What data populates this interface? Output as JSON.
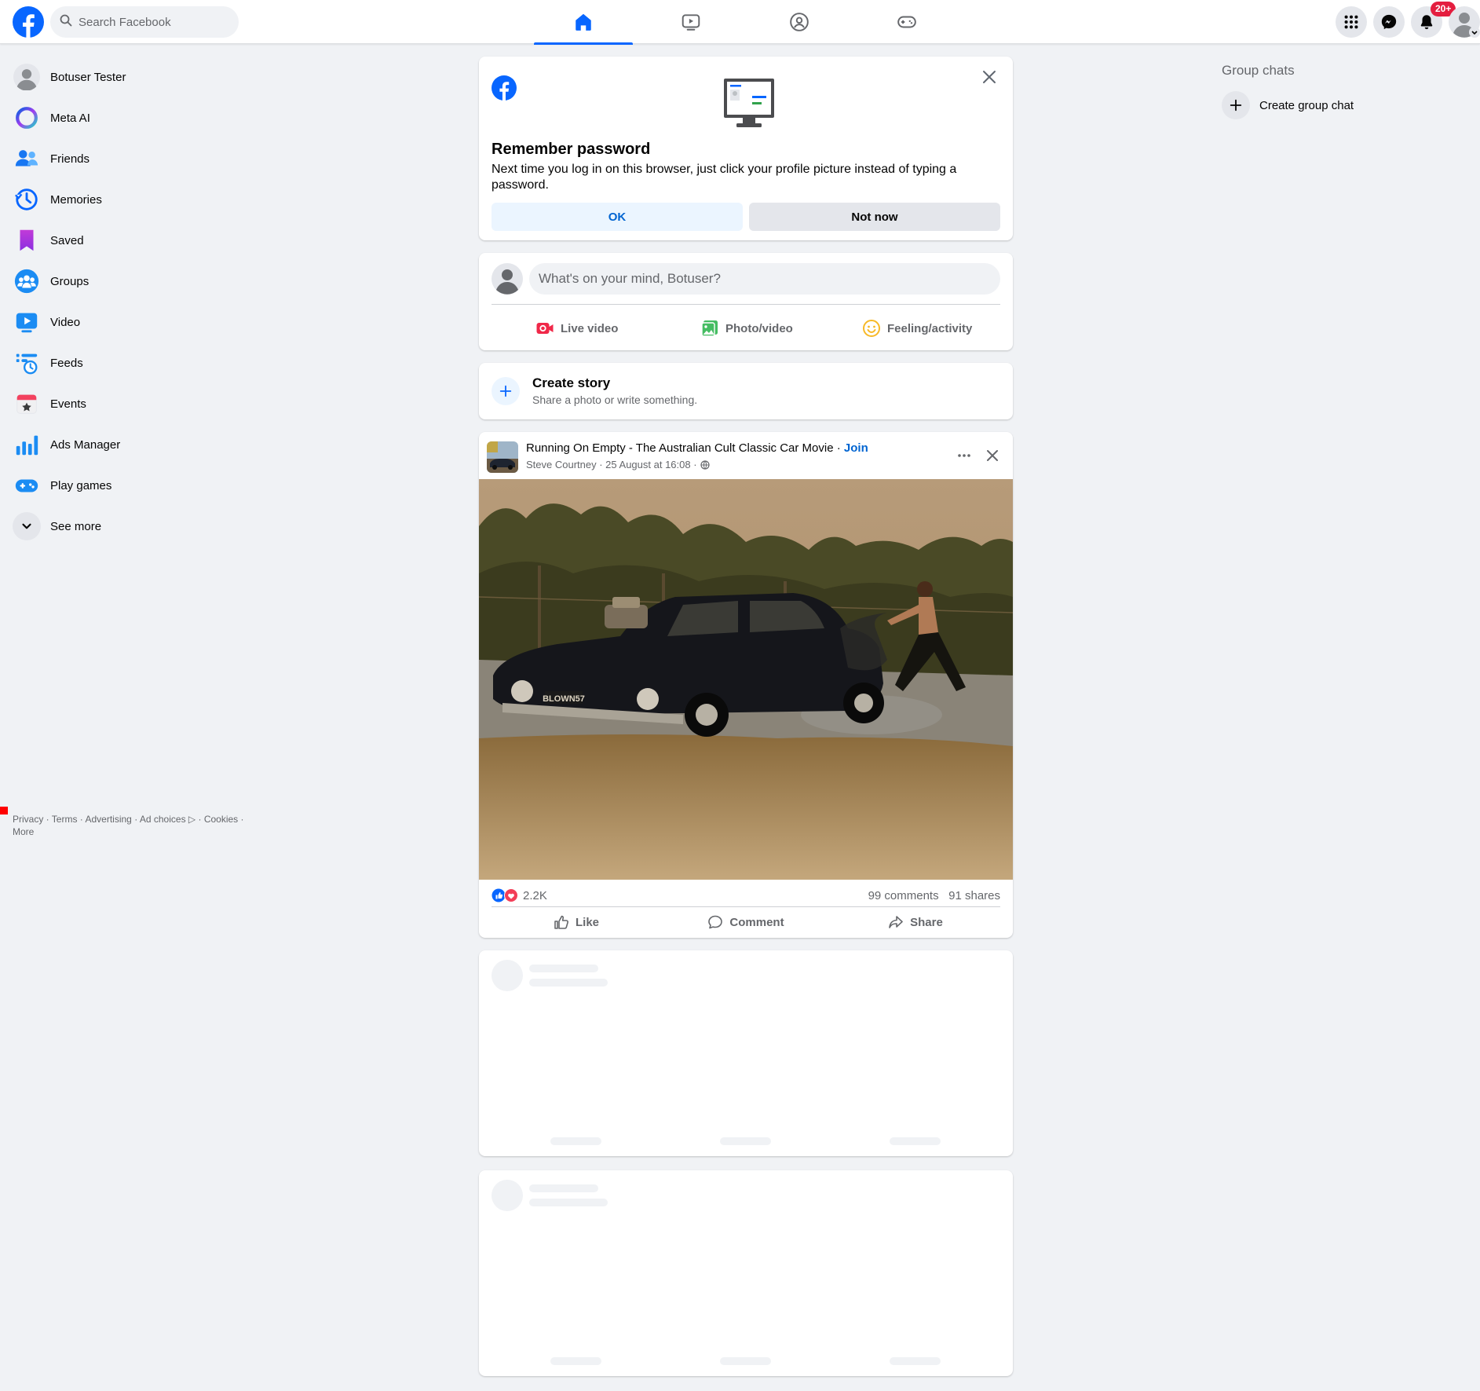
{
  "search": {
    "placeholder": "Search Facebook"
  },
  "notifications": {
    "badge": "20+"
  },
  "sidebar": {
    "items": [
      {
        "label": "Botuser Tester"
      },
      {
        "label": "Meta AI"
      },
      {
        "label": "Friends"
      },
      {
        "label": "Memories"
      },
      {
        "label": "Saved"
      },
      {
        "label": "Groups"
      },
      {
        "label": "Video"
      },
      {
        "label": "Feeds"
      },
      {
        "label": "Events"
      },
      {
        "label": "Ads Manager"
      },
      {
        "label": "Play games"
      },
      {
        "label": "See more"
      }
    ]
  },
  "footer": {
    "privacy": "Privacy",
    "terms": "Terms",
    "advertising": "Advertising",
    "ad_choices": "Ad choices",
    "cookies": "Cookies",
    "more": "More"
  },
  "remember": {
    "title": "Remember password",
    "body": "Next time you log in on this browser, just click your profile picture instead of typing a password.",
    "ok": "OK",
    "not_now": "Not now"
  },
  "composer": {
    "prompt": "What's on your mind, Botuser?",
    "live": "Live video",
    "photo": "Photo/video",
    "feeling": "Feeling/activity"
  },
  "story": {
    "title": "Create story",
    "subtitle": "Share a photo or write something."
  },
  "post": {
    "group": "Running On Empty - The Australian Cult Classic Car Movie",
    "join": "Join",
    "author": "Steve Courtney",
    "time": "25 August at 16:08",
    "reactions": "2.2K",
    "comments": "99 comments",
    "shares": "91 shares",
    "plate": "BLOWN57",
    "like": "Like",
    "comment": "Comment",
    "share": "Share"
  },
  "right": {
    "group_chats": "Group chats",
    "create_group": "Create group chat"
  },
  "colors": {
    "brand": "#0866ff",
    "background": "#f0f2f5",
    "notification_badge": "#e41e3f"
  }
}
